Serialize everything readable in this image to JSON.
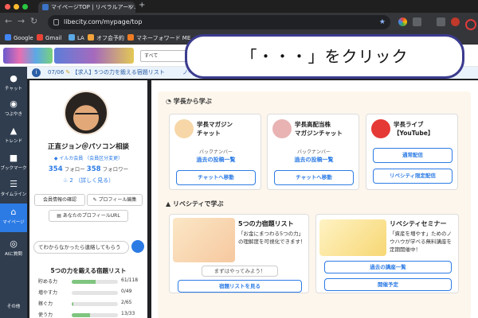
{
  "browser": {
    "tab_title": "マイページTOP | リベラルアーツ...",
    "url": "libecity.com/mypage/top",
    "bookmarks": [
      "Google",
      "Gmail",
      "LA",
      "オフ会予約",
      "マネーフォワード ME"
    ]
  },
  "site": {
    "search_select": "すべて",
    "ticker_date": "07/06",
    "ticker_text": "【求人】5つの力を鍛える宿題リスト",
    "ticker_more": "ノート"
  },
  "nav": [
    {
      "label": "チャット",
      "icon": "chat-icon"
    },
    {
      "label": "つぶやき",
      "icon": "tweet-icon"
    },
    {
      "label": "トレンド",
      "icon": "trend-icon"
    },
    {
      "label": "ブックマーク",
      "icon": "bookmark-icon"
    },
    {
      "label": "タイムライン",
      "icon": "timeline-icon"
    },
    {
      "label": "マイページ",
      "icon": "home-icon"
    },
    {
      "label": "AIに質問",
      "icon": "ai-icon"
    },
    {
      "label": "その他",
      "icon": "other-icon"
    }
  ],
  "profile": {
    "name": "正直ジョン＠パソコン相談",
    "badge_member": "イルカ会員",
    "badge_other": "（会員区分変更）",
    "follow_count": "354",
    "follow_label": "フォロー",
    "follower_count": "358",
    "follower_label": "フォロワー",
    "likes_count": "2",
    "likes_more": "（詳しく見る）",
    "btn_check": "会員情報の確認",
    "btn_edit": "プロフィール編集",
    "btn_url": "あなたのプロフィールURL",
    "chat_placeholder": "てわからなかったら連絡してもらう"
  },
  "tasks": {
    "title": "5つの力を鍛える宿題リスト",
    "rows": [
      {
        "label": "貯める力",
        "value": 61,
        "total": 118,
        "text": "61/118"
      },
      {
        "label": "増やす力",
        "value": 0,
        "total": 49,
        "text": "0/49"
      },
      {
        "label": "稼ぐ力",
        "value": 2,
        "total": 65,
        "text": "2/65"
      },
      {
        "label": "使う力",
        "value": 13,
        "total": 33,
        "text": "13/33"
      }
    ]
  },
  "main": {
    "section1_title": "学長から学ぶ",
    "cards": [
      {
        "title_line1": "学長マガジン",
        "title_line2": "チャット",
        "sub": "バックナンバー",
        "link": "過去の投稿一覧",
        "button": "チャットへ移動"
      },
      {
        "title_line1": "学長高配当株",
        "title_line2": "マガジンチャット",
        "sub": "バックナンバー",
        "link": "過去の投稿一覧",
        "button": "チャットへ移動"
      },
      {
        "title_line1": "学長ライブ",
        "title_line2": "【YouTube】",
        "btn1": "通常配信",
        "btn2": "リベシティ限定配信"
      }
    ],
    "section2_title": "リベシティで学ぶ",
    "learn": [
      {
        "title": "5つの力宿題リスト",
        "desc": "「お金にまつわる5つの力」の理解度を可視化できます！",
        "try": "まずはやってみよう！",
        "button": "宿題リストを見る"
      },
      {
        "title": "リベシティセミナー",
        "desc": "「資産を増やす」ためのノウハウが学べる無料講座を定期開催中！",
        "button": "過去の講座一覧",
        "button2": "開催予定"
      }
    ]
  },
  "callout": "「・・・」をクリック",
  "colors": {
    "accent": "#2c7be5",
    "nav": "#2f3d4f",
    "panel": "#fdf6ec",
    "callout_border": "#3b3b8f"
  }
}
